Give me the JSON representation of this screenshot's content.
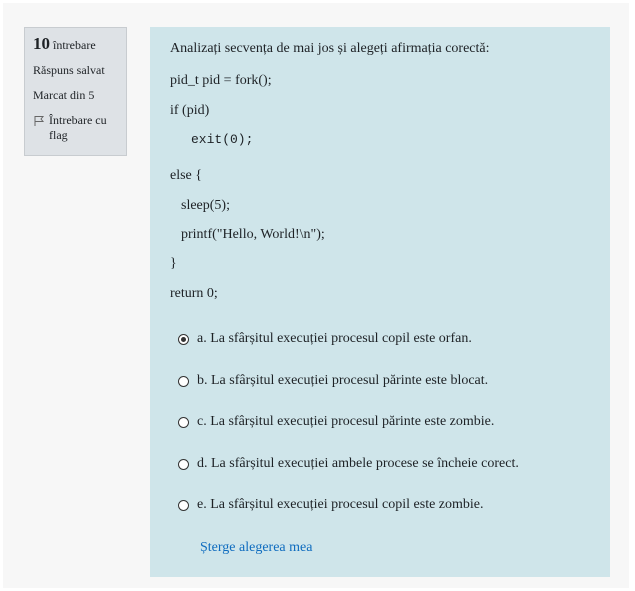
{
  "info": {
    "number": "10",
    "number_label": "întrebare",
    "state": "Răspuns salvat",
    "grade": "Marcat din 5",
    "flag_label": "Întrebare cu flag"
  },
  "question": {
    "prompt": "Analizați secvența de mai jos și alegeți afirmația corectă:",
    "code": [
      "pid_t pid = fork();",
      "if (pid)",
      "exit(0);",
      "else {",
      "sleep(5);",
      "printf(\"Hello, World!\\n\");",
      "}",
      "return 0;"
    ]
  },
  "answers": [
    {
      "label": "a. La sfârșitul execuției procesul copil este orfan.",
      "selected": true
    },
    {
      "label": "b. La sfârșitul execuției procesul părinte este blocat.",
      "selected": false
    },
    {
      "label": "c. La sfârșitul execuției procesul părinte este zombie.",
      "selected": false
    },
    {
      "label": "d. La sfârșitul execuției ambele procese se încheie corect.",
      "selected": false
    },
    {
      "label": "e. La sfârșitul execuției procesul copil este zombie.",
      "selected": false
    }
  ],
  "clear_choice": "Șterge alegerea mea",
  "colors": {
    "info_bg": "#dee2e6",
    "content_bg": "#cfe5ea",
    "link": "#0f6cbf"
  }
}
